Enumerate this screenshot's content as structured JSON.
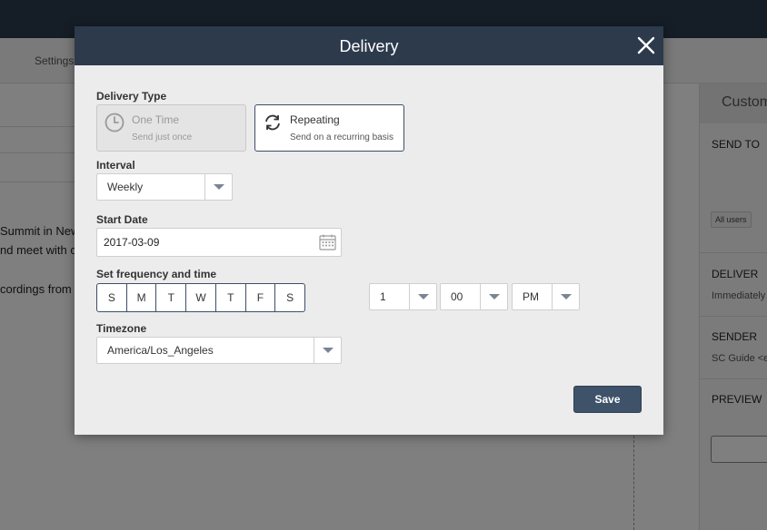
{
  "background": {
    "settings_label": "Settings",
    "text_lines": [
      "Summit in New",
      "nd meet with c",
      "cordings from"
    ],
    "right_panel": {
      "title": "Custom",
      "send_to": "SEND TO",
      "chip": "All users",
      "deliver": "DELIVER",
      "deliver_value": "Immediately",
      "sender": "SENDER",
      "sender_value": "SC Guide <e",
      "preview": "PREVIEW"
    }
  },
  "modal": {
    "title": "Delivery",
    "close_icon": "close-icon",
    "delivery_type": {
      "label": "Delivery Type",
      "options": [
        {
          "title": "One Time",
          "subtitle": "Send just once",
          "icon": "clock-icon",
          "selected": false
        },
        {
          "title": "Repeating",
          "subtitle": "Send on a recurring basis",
          "icon": "refresh-icon",
          "selected": true
        }
      ]
    },
    "interval": {
      "label": "Interval",
      "value": "Weekly"
    },
    "start_date": {
      "label": "Start Date",
      "value": "2017-03-09",
      "icon": "calendar-icon"
    },
    "frequency": {
      "label": "Set frequency and time",
      "days": [
        "S",
        "M",
        "T",
        "W",
        "T",
        "F",
        "S"
      ],
      "hour": "1",
      "minute": "00",
      "ampm": "PM"
    },
    "timezone": {
      "label": "Timezone",
      "value": "America/Los_Angeles"
    },
    "save_label": "Save"
  },
  "colors": {
    "header": "#2c3a4c",
    "accent": "#3e5269",
    "modal_bg": "#ececec"
  }
}
